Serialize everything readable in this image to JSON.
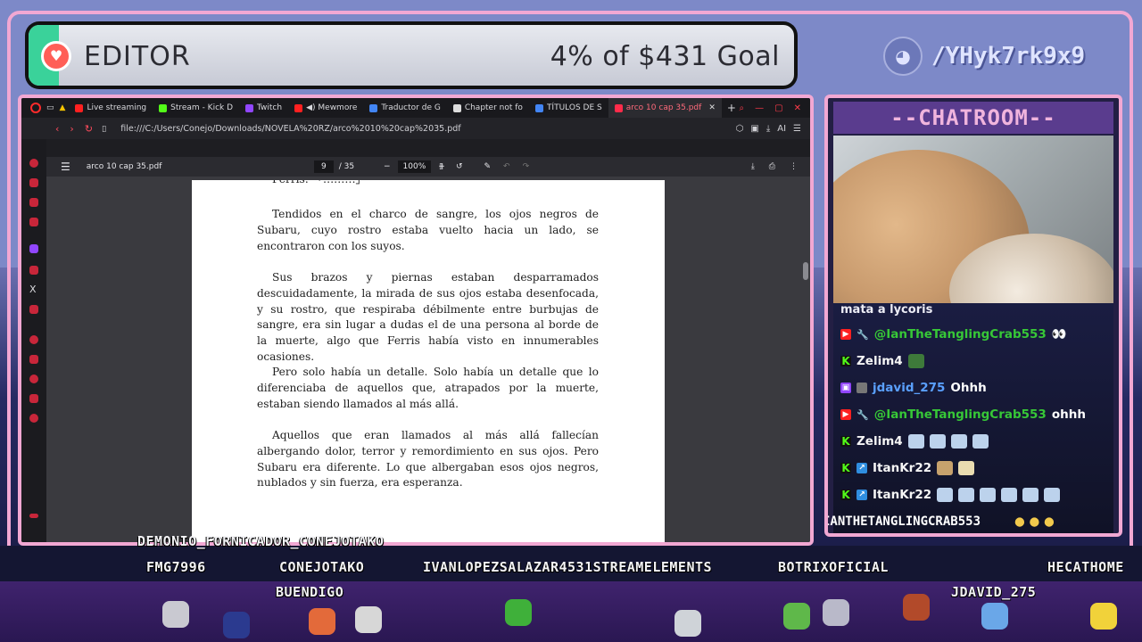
{
  "goal": {
    "title": "EDITOR",
    "amount_text": "4% of $431 Goal",
    "percent": 4
  },
  "discord": {
    "handle": "/YHyk7rk9x9"
  },
  "browser": {
    "tabs": [
      {
        "label": "Live streaming",
        "color": "#ff2020"
      },
      {
        "label": "Stream - Kick D",
        "color": "#53fc18"
      },
      {
        "label": "Twitch",
        "color": "#9146ff"
      },
      {
        "label": "◀) Mewmore",
        "color": "#ff2020"
      },
      {
        "label": "Traductor de G",
        "color": "#4285f4"
      },
      {
        "label": "Chapter not fo",
        "color": "#dddddd"
      },
      {
        "label": "TÍTULOS DE S",
        "color": "#4285f4"
      },
      {
        "label": "arco 10 cap 35.pdf",
        "color": "#ff2b4a"
      }
    ],
    "url": "file:///C:/Users/Conejo/Downloads/NOVELA%20RZ/arco%2010%20cap%2035.pdf",
    "ai_label": "AI",
    "pdf": {
      "filename": "arco 10 cap 35.pdf",
      "page_current": "9",
      "page_total": "/ 35",
      "zoom": "100%",
      "top_cut": "Ferris: 「………」",
      "paragraphs": [
        "Tendidos en el charco de sangre, los ojos negros de Subaru, cuyo rostro estaba vuelto hacia un lado, se encontraron con los suyos.",
        "Sus brazos y piernas estaban desparramados descuidadamente, la mirada de sus ojos estaba desenfocada, y su rostro, que respiraba débilmente entre burbujas de sangre, era sin lugar a dudas el de una persona al borde de la muerte, algo que Ferris había visto en innumerables ocasiones.",
        "Pero solo había un detalle. Solo había un detalle que lo diferenciaba de aquellos que, atrapados por la muerte, estaban siendo llamados al más allá.",
        "Aquellos que eran llamados al más allá fallecían albergando dolor, terror y remordimiento en sus ojos. Pero Subaru era diferente. Lo que albergaban esos ojos negros, nublados y sin fuerza, era esperanza."
      ]
    }
  },
  "chat": {
    "title": "--CHATROOM--",
    "top_line": "mata a lycoris",
    "messages": [
      {
        "platform": "yt",
        "user": "@IanTheTanglingCrab553",
        "color": "#37c837",
        "text": "",
        "emotes": 1
      },
      {
        "platform": "kick",
        "user": "Zelim4",
        "color": "#f5f5f5",
        "text": "",
        "emotes": 1
      },
      {
        "platform": "tw",
        "user": "jdavid_275",
        "color": "#5aa0ff",
        "text": "Ohhh",
        "emotes": 0
      },
      {
        "platform": "yt",
        "user": "@IanTheTanglingCrab553",
        "color": "#37c837",
        "text": "ohhh",
        "emotes": 0
      },
      {
        "platform": "kick",
        "user": "Zelim4",
        "color": "#f5f5f5",
        "text": "",
        "emotes": 4
      },
      {
        "platform": "kick",
        "user": "ItanKr22",
        "color": "#f5f5f5",
        "text": "",
        "emotes": 2
      },
      {
        "platform": "kick",
        "user": "ItanKr22",
        "color": "#f5f5f5",
        "text": "",
        "emotes": 6
      }
    ],
    "overlay_name": "IANTHETANGLINGCRAB553"
  },
  "bottom_names": [
    "DEMONIO_FORNICADOR_CONEJOTAKO",
    "FMG7996",
    "CONEJOTAKO",
    "IVANLOPEZSALAZAR4531STREAMELEMENTS",
    "BOTRIXOFICIAL",
    "HECATHOME",
    "BUENDIGO",
    "JDAVID_275"
  ]
}
